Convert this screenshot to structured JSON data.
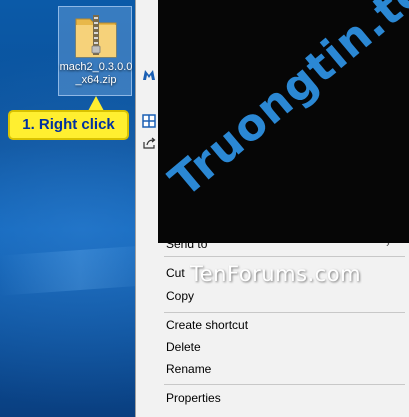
{
  "desktop": {
    "file": {
      "name": "mach2_0.3.0.0_x64.zip",
      "icon": "zip-folder-icon"
    }
  },
  "callout": {
    "text": "1. Right click"
  },
  "context_menu": {
    "items": [
      {
        "label": "Send to",
        "has_submenu": true
      },
      {
        "label": "Cut"
      },
      {
        "label": "Copy"
      },
      {
        "label": "Create shortcut"
      },
      {
        "label": "Delete"
      },
      {
        "label": "Rename"
      },
      {
        "label": "Properties"
      }
    ]
  },
  "watermarks": {
    "primary": "Truongtin.top",
    "secondary": "TenForums.com"
  },
  "colors": {
    "callout_bg": "#ffef30",
    "callout_text": "#0030a0",
    "menu_bg": "#f2f2f2",
    "watermark_blue": "#2d8fe0"
  }
}
